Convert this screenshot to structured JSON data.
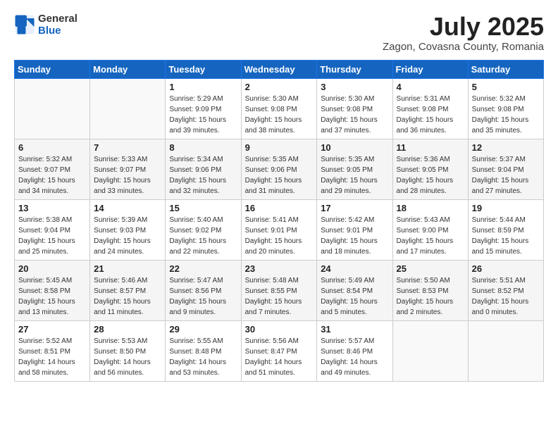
{
  "header": {
    "logo_general": "General",
    "logo_blue": "Blue",
    "month_title": "July 2025",
    "location": "Zagon, Covasna County, Romania"
  },
  "weekdays": [
    "Sunday",
    "Monday",
    "Tuesday",
    "Wednesday",
    "Thursday",
    "Friday",
    "Saturday"
  ],
  "weeks": [
    [
      {
        "day": "",
        "sunrise": "",
        "sunset": "",
        "daylight": ""
      },
      {
        "day": "",
        "sunrise": "",
        "sunset": "",
        "daylight": ""
      },
      {
        "day": "1",
        "sunrise": "Sunrise: 5:29 AM",
        "sunset": "Sunset: 9:09 PM",
        "daylight": "Daylight: 15 hours and 39 minutes."
      },
      {
        "day": "2",
        "sunrise": "Sunrise: 5:30 AM",
        "sunset": "Sunset: 9:08 PM",
        "daylight": "Daylight: 15 hours and 38 minutes."
      },
      {
        "day": "3",
        "sunrise": "Sunrise: 5:30 AM",
        "sunset": "Sunset: 9:08 PM",
        "daylight": "Daylight: 15 hours and 37 minutes."
      },
      {
        "day": "4",
        "sunrise": "Sunrise: 5:31 AM",
        "sunset": "Sunset: 9:08 PM",
        "daylight": "Daylight: 15 hours and 36 minutes."
      },
      {
        "day": "5",
        "sunrise": "Sunrise: 5:32 AM",
        "sunset": "Sunset: 9:08 PM",
        "daylight": "Daylight: 15 hours and 35 minutes."
      }
    ],
    [
      {
        "day": "6",
        "sunrise": "Sunrise: 5:32 AM",
        "sunset": "Sunset: 9:07 PM",
        "daylight": "Daylight: 15 hours and 34 minutes."
      },
      {
        "day": "7",
        "sunrise": "Sunrise: 5:33 AM",
        "sunset": "Sunset: 9:07 PM",
        "daylight": "Daylight: 15 hours and 33 minutes."
      },
      {
        "day": "8",
        "sunrise": "Sunrise: 5:34 AM",
        "sunset": "Sunset: 9:06 PM",
        "daylight": "Daylight: 15 hours and 32 minutes."
      },
      {
        "day": "9",
        "sunrise": "Sunrise: 5:35 AM",
        "sunset": "Sunset: 9:06 PM",
        "daylight": "Daylight: 15 hours and 31 minutes."
      },
      {
        "day": "10",
        "sunrise": "Sunrise: 5:35 AM",
        "sunset": "Sunset: 9:05 PM",
        "daylight": "Daylight: 15 hours and 29 minutes."
      },
      {
        "day": "11",
        "sunrise": "Sunrise: 5:36 AM",
        "sunset": "Sunset: 9:05 PM",
        "daylight": "Daylight: 15 hours and 28 minutes."
      },
      {
        "day": "12",
        "sunrise": "Sunrise: 5:37 AM",
        "sunset": "Sunset: 9:04 PM",
        "daylight": "Daylight: 15 hours and 27 minutes."
      }
    ],
    [
      {
        "day": "13",
        "sunrise": "Sunrise: 5:38 AM",
        "sunset": "Sunset: 9:04 PM",
        "daylight": "Daylight: 15 hours and 25 minutes."
      },
      {
        "day": "14",
        "sunrise": "Sunrise: 5:39 AM",
        "sunset": "Sunset: 9:03 PM",
        "daylight": "Daylight: 15 hours and 24 minutes."
      },
      {
        "day": "15",
        "sunrise": "Sunrise: 5:40 AM",
        "sunset": "Sunset: 9:02 PM",
        "daylight": "Daylight: 15 hours and 22 minutes."
      },
      {
        "day": "16",
        "sunrise": "Sunrise: 5:41 AM",
        "sunset": "Sunset: 9:01 PM",
        "daylight": "Daylight: 15 hours and 20 minutes."
      },
      {
        "day": "17",
        "sunrise": "Sunrise: 5:42 AM",
        "sunset": "Sunset: 9:01 PM",
        "daylight": "Daylight: 15 hours and 18 minutes."
      },
      {
        "day": "18",
        "sunrise": "Sunrise: 5:43 AM",
        "sunset": "Sunset: 9:00 PM",
        "daylight": "Daylight: 15 hours and 17 minutes."
      },
      {
        "day": "19",
        "sunrise": "Sunrise: 5:44 AM",
        "sunset": "Sunset: 8:59 PM",
        "daylight": "Daylight: 15 hours and 15 minutes."
      }
    ],
    [
      {
        "day": "20",
        "sunrise": "Sunrise: 5:45 AM",
        "sunset": "Sunset: 8:58 PM",
        "daylight": "Daylight: 15 hours and 13 minutes."
      },
      {
        "day": "21",
        "sunrise": "Sunrise: 5:46 AM",
        "sunset": "Sunset: 8:57 PM",
        "daylight": "Daylight: 15 hours and 11 minutes."
      },
      {
        "day": "22",
        "sunrise": "Sunrise: 5:47 AM",
        "sunset": "Sunset: 8:56 PM",
        "daylight": "Daylight: 15 hours and 9 minutes."
      },
      {
        "day": "23",
        "sunrise": "Sunrise: 5:48 AM",
        "sunset": "Sunset: 8:55 PM",
        "daylight": "Daylight: 15 hours and 7 minutes."
      },
      {
        "day": "24",
        "sunrise": "Sunrise: 5:49 AM",
        "sunset": "Sunset: 8:54 PM",
        "daylight": "Daylight: 15 hours and 5 minutes."
      },
      {
        "day": "25",
        "sunrise": "Sunrise: 5:50 AM",
        "sunset": "Sunset: 8:53 PM",
        "daylight": "Daylight: 15 hours and 2 minutes."
      },
      {
        "day": "26",
        "sunrise": "Sunrise: 5:51 AM",
        "sunset": "Sunset: 8:52 PM",
        "daylight": "Daylight: 15 hours and 0 minutes."
      }
    ],
    [
      {
        "day": "27",
        "sunrise": "Sunrise: 5:52 AM",
        "sunset": "Sunset: 8:51 PM",
        "daylight": "Daylight: 14 hours and 58 minutes."
      },
      {
        "day": "28",
        "sunrise": "Sunrise: 5:53 AM",
        "sunset": "Sunset: 8:50 PM",
        "daylight": "Daylight: 14 hours and 56 minutes."
      },
      {
        "day": "29",
        "sunrise": "Sunrise: 5:55 AM",
        "sunset": "Sunset: 8:48 PM",
        "daylight": "Daylight: 14 hours and 53 minutes."
      },
      {
        "day": "30",
        "sunrise": "Sunrise: 5:56 AM",
        "sunset": "Sunset: 8:47 PM",
        "daylight": "Daylight: 14 hours and 51 minutes."
      },
      {
        "day": "31",
        "sunrise": "Sunrise: 5:57 AM",
        "sunset": "Sunset: 8:46 PM",
        "daylight": "Daylight: 14 hours and 49 minutes."
      },
      {
        "day": "",
        "sunrise": "",
        "sunset": "",
        "daylight": ""
      },
      {
        "day": "",
        "sunrise": "",
        "sunset": "",
        "daylight": ""
      }
    ]
  ]
}
